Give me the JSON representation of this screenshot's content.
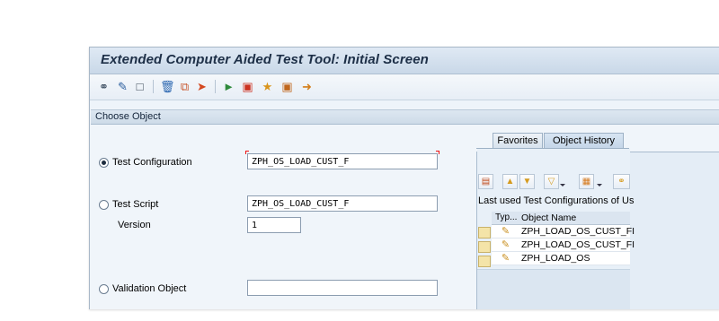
{
  "window": {
    "title": "Extended Computer Aided Test Tool: Initial Screen"
  },
  "toolbar": {
    "icons": [
      "glasses-icon",
      "pencil-icon",
      "new-document-icon",
      "trash-icon",
      "copy-icon",
      "rename-icon",
      "execute-icon",
      "display-icon",
      "translate-icon",
      "transport-icon",
      "export-icon"
    ]
  },
  "choose_object": {
    "title": "Choose Object",
    "options": [
      {
        "label": "Test Configuration",
        "value": "ZPH_OS_LOAD_CUST_F",
        "selected": true
      },
      {
        "label": "Test Script",
        "value": "ZPH_OS_LOAD_CUST_F",
        "selected": false
      },
      {
        "label": "Validation Object",
        "value": "",
        "selected": false
      }
    ],
    "version": {
      "label": "Version",
      "value": "1"
    }
  },
  "history_panel": {
    "tabs": [
      {
        "label": "Favorites",
        "active": false
      },
      {
        "label": "Object History",
        "active": true
      }
    ],
    "header": "Last used  Test Configurations of Us",
    "columns": [
      "Typ...",
      "Object Name"
    ],
    "rows": [
      {
        "name": "ZPH_LOAD_OS_CUST_FI"
      },
      {
        "name": "ZPH_LOAD_OS_CUST_FI"
      },
      {
        "name": "ZPH_LOAD_OS"
      }
    ]
  }
}
